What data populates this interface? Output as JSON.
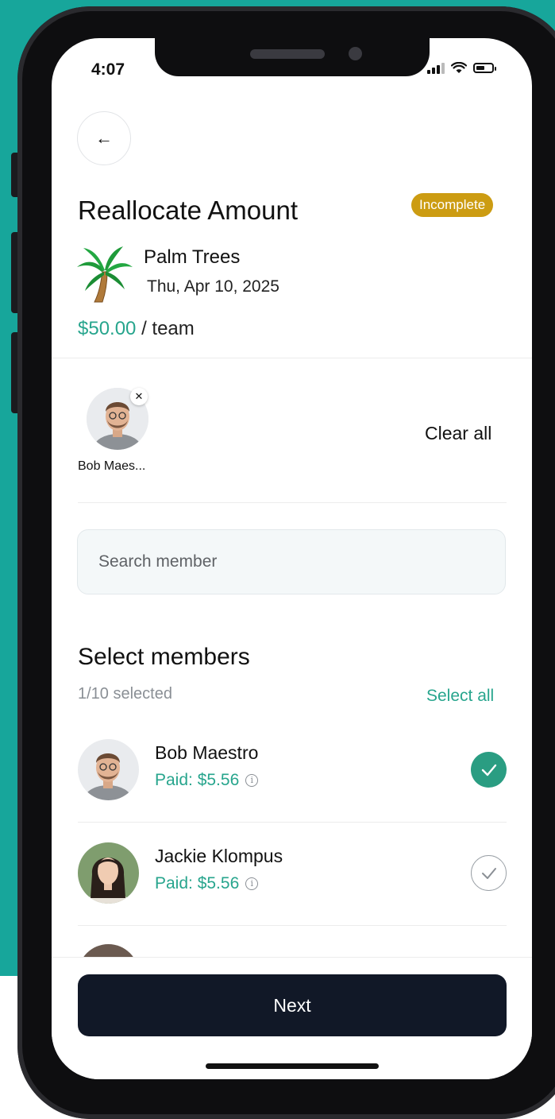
{
  "status_bar": {
    "time": "4:07"
  },
  "header": {
    "title": "Reallocate Amount",
    "badge": "Incomplete"
  },
  "event": {
    "name": "Palm Trees",
    "date": "Thu, Apr 10, 2025",
    "amount": "$50.00",
    "amount_suffix": "/ team"
  },
  "selected_chips": [
    {
      "name": "Bob Maes..."
    }
  ],
  "clear_all_label": "Clear all",
  "search": {
    "placeholder": "Search member",
    "value": ""
  },
  "members_section": {
    "title": "Select members",
    "count": "1/10 selected",
    "select_all_label": "Select all"
  },
  "members": [
    {
      "name": "Bob Maestro",
      "paid": "Paid: $5.56",
      "selected": true
    },
    {
      "name": "Jackie Klompus",
      "paid": "Paid: $5.56",
      "selected": false
    }
  ],
  "next_label": "Next",
  "colors": {
    "teal_background": "#17a69b",
    "accent_green": "#27a58d",
    "badge_gold": "#cc9c12",
    "button_dark": "#111827",
    "check_on": "#2a9d82"
  },
  "icons": [
    "back-arrow-icon",
    "palm-tree-icon",
    "close-icon",
    "info-icon",
    "check-icon",
    "signal-icon",
    "wifi-icon",
    "battery-icon"
  ]
}
